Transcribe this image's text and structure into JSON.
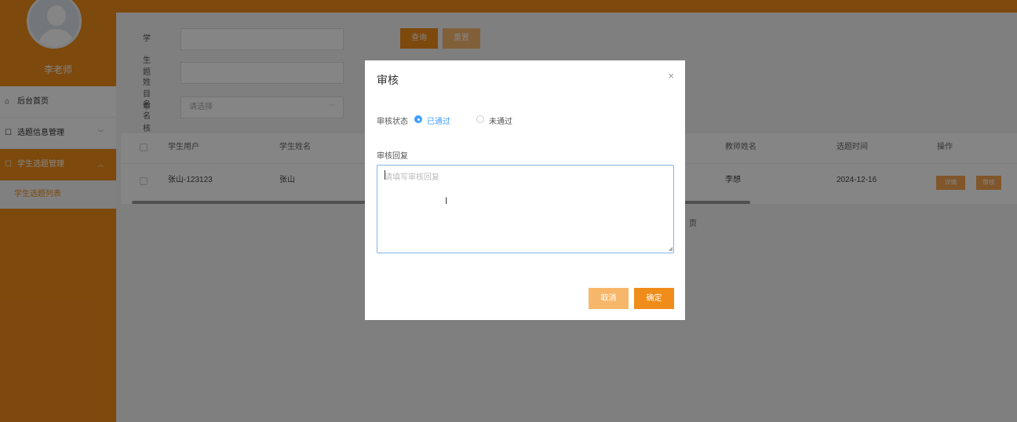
{
  "sidebar": {
    "user_name": "李老师",
    "items": [
      {
        "label": "后台首页",
        "icon": "home-icon"
      },
      {
        "label": "选题信息管理",
        "icon": "document-icon",
        "chevron": "﹀"
      },
      {
        "label": "学生选题管理",
        "icon": "document-icon",
        "chevron": "︿"
      }
    ],
    "subitem": "学生选题列表"
  },
  "search": {
    "student_name_label": "学生姓名",
    "topic_name_label": "题目名称",
    "review_status_label": "审核状态",
    "review_status_placeholder": "请选择",
    "query_button": "查询",
    "reset_button": "重置"
  },
  "table": {
    "headers": [
      "学生用户",
      "学生姓名",
      "教师姓名",
      "选题时间",
      "操作"
    ],
    "rows": [
      {
        "student_user": "张山-123123",
        "student_name": "张山",
        "teacher_name": "李想",
        "date": "2024-12-16",
        "detail_button": "详情",
        "review_button": "审核"
      }
    ]
  },
  "pagination": {
    "page_suffix": "页"
  },
  "dialog": {
    "title": "审核",
    "close": "×",
    "status_label": "审核状态",
    "status_options": [
      "已通过",
      "未通过"
    ],
    "status_selected": "已通过",
    "reply_label": "审核回复",
    "reply_placeholder": "请填写审核回复",
    "cancel_button": "取消",
    "confirm_button": "确定"
  },
  "colors": {
    "accent": "#f08c1a",
    "accent_light": "#f7b76b",
    "radio_active": "#409eff"
  }
}
